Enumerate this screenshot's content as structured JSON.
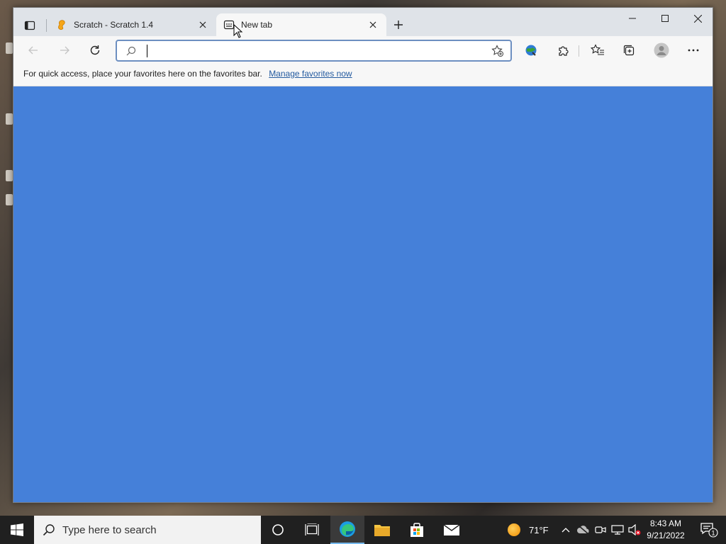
{
  "tabs": [
    {
      "label": "Scratch - Scratch 1.4",
      "favicon": "scratch-icon",
      "active": false
    },
    {
      "label": "New tab",
      "favicon": "new-tab-icon",
      "active": true
    }
  ],
  "address": {
    "value": "",
    "placeholder": ""
  },
  "favorites_bar": {
    "message": "For quick access, place your favorites here on the favorites bar.",
    "link": "Manage favorites now"
  },
  "taskbar": {
    "search_placeholder": "Type here to search",
    "weather_temp": "71°F",
    "time": "8:43 AM",
    "date": "9/21/2022",
    "notification_count": "1"
  },
  "colors": {
    "content_bg": "#4580d9",
    "tabstrip_bg": "#dfe3e8",
    "taskbar_bg": "#202020",
    "link": "#235a9f"
  }
}
